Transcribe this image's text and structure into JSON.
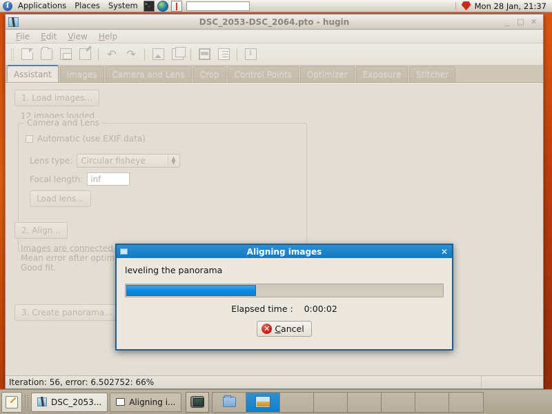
{
  "panel": {
    "logo": "fedora-logo",
    "menus": [
      "Applications",
      "Places",
      "System"
    ],
    "launchers": [
      {
        "name": "terminal-launcher-icon"
      },
      {
        "name": "web-browser-launcher-icon"
      },
      {
        "name": "help-launcher-icon"
      }
    ],
    "entry_value": "",
    "tray_icon": "gem-icon",
    "clock": "Mon 28 Jan, 21:37"
  },
  "window": {
    "icon": "hugin-window-icon",
    "title": "DSC_2053-DSC_2064.pto - hugin",
    "buttons": {
      "minimize": "_",
      "maximize": "□",
      "close": "✕"
    },
    "menus": [
      "File",
      "Edit",
      "View",
      "Help"
    ],
    "toolbar": [
      {
        "name": "new-project-icon",
        "label": "New"
      },
      {
        "name": "open-project-icon",
        "label": "Open"
      },
      {
        "name": "save-project-icon",
        "label": "Save"
      },
      {
        "name": "save-as-project-icon",
        "label": "Save as"
      },
      {
        "name": "undo-icon",
        "label": "Undo"
      },
      {
        "name": "redo-icon",
        "label": "Redo"
      },
      {
        "name": "add-image-icon",
        "label": "Add image"
      },
      {
        "name": "add-images-icon",
        "label": "Add images"
      },
      {
        "name": "preview-panorama-icon",
        "label": "Preview panorama"
      },
      {
        "name": "show-control-points-icon",
        "label": "Show list"
      },
      {
        "name": "about-info-icon",
        "label": "About"
      }
    ],
    "tabs": [
      {
        "label": "Assistant",
        "active": true
      },
      {
        "label": "Images",
        "active": false
      },
      {
        "label": "Camera and Lens",
        "active": false
      },
      {
        "label": "Crop",
        "active": false
      },
      {
        "label": "Control Points",
        "active": false
      },
      {
        "label": "Optimizer",
        "active": false
      },
      {
        "label": "Exposure",
        "active": false
      },
      {
        "label": "Stitcher",
        "active": false
      }
    ]
  },
  "assistant": {
    "load_button": "1. Load images...",
    "images_loaded": "12 images loaded.",
    "group_label": "Camera and Lens",
    "automatic_checkbox": "Automatic (use EXIF data)",
    "automatic_checked": false,
    "lens_type_label": "Lens type:",
    "lens_type_value": "Circular fisheye",
    "focal_length_label": "Focal length:",
    "focal_length_value": "inf",
    "load_lens_button": "Load lens...",
    "align_button": "2. Align...",
    "align_status_line1": "Images are connected b",
    "align_status_line2": "Mean error after optimi",
    "align_status_line3": "Good fit.",
    "create_button": "3. Create panorama..."
  },
  "statusbar": {
    "text": "Iteration: 56, error: 6.502752: 66%"
  },
  "dialog": {
    "icon": "dialog-window-icon",
    "title": "Aligning images",
    "close_label": "✕",
    "message": "leveling the panorama",
    "progress_percent": 41,
    "elapsed_label": "Elapsed time :",
    "elapsed_value": "0:00:02",
    "cancel_button": "Cancel",
    "cancel_icon": "cancel-x-icon",
    "accent_color": "#1279c0",
    "progress_color": "#0c87dd"
  },
  "taskbar": {
    "show_desktop_icon": "show-desktop-icon",
    "tasks": [
      {
        "icon": "hugin-task-icon",
        "label": "DSC_2053...",
        "active": false
      },
      {
        "icon": "dialog-task-icon",
        "label": "Aligning i...",
        "active": true
      }
    ],
    "tray_icon": "terminal-tray-icon",
    "workspaces": [
      {
        "index": 1,
        "current": false,
        "content": "folder-thumbnail"
      },
      {
        "index": 2,
        "current": true,
        "content": "panorama-thumbnail"
      },
      {
        "index": 3,
        "current": false,
        "content": ""
      },
      {
        "index": 4,
        "current": false,
        "content": ""
      },
      {
        "index": 5,
        "current": false,
        "content": ""
      },
      {
        "index": 6,
        "current": false,
        "content": ""
      },
      {
        "index": 7,
        "current": false,
        "content": ""
      },
      {
        "index": 8,
        "current": false,
        "content": ""
      }
    ]
  }
}
